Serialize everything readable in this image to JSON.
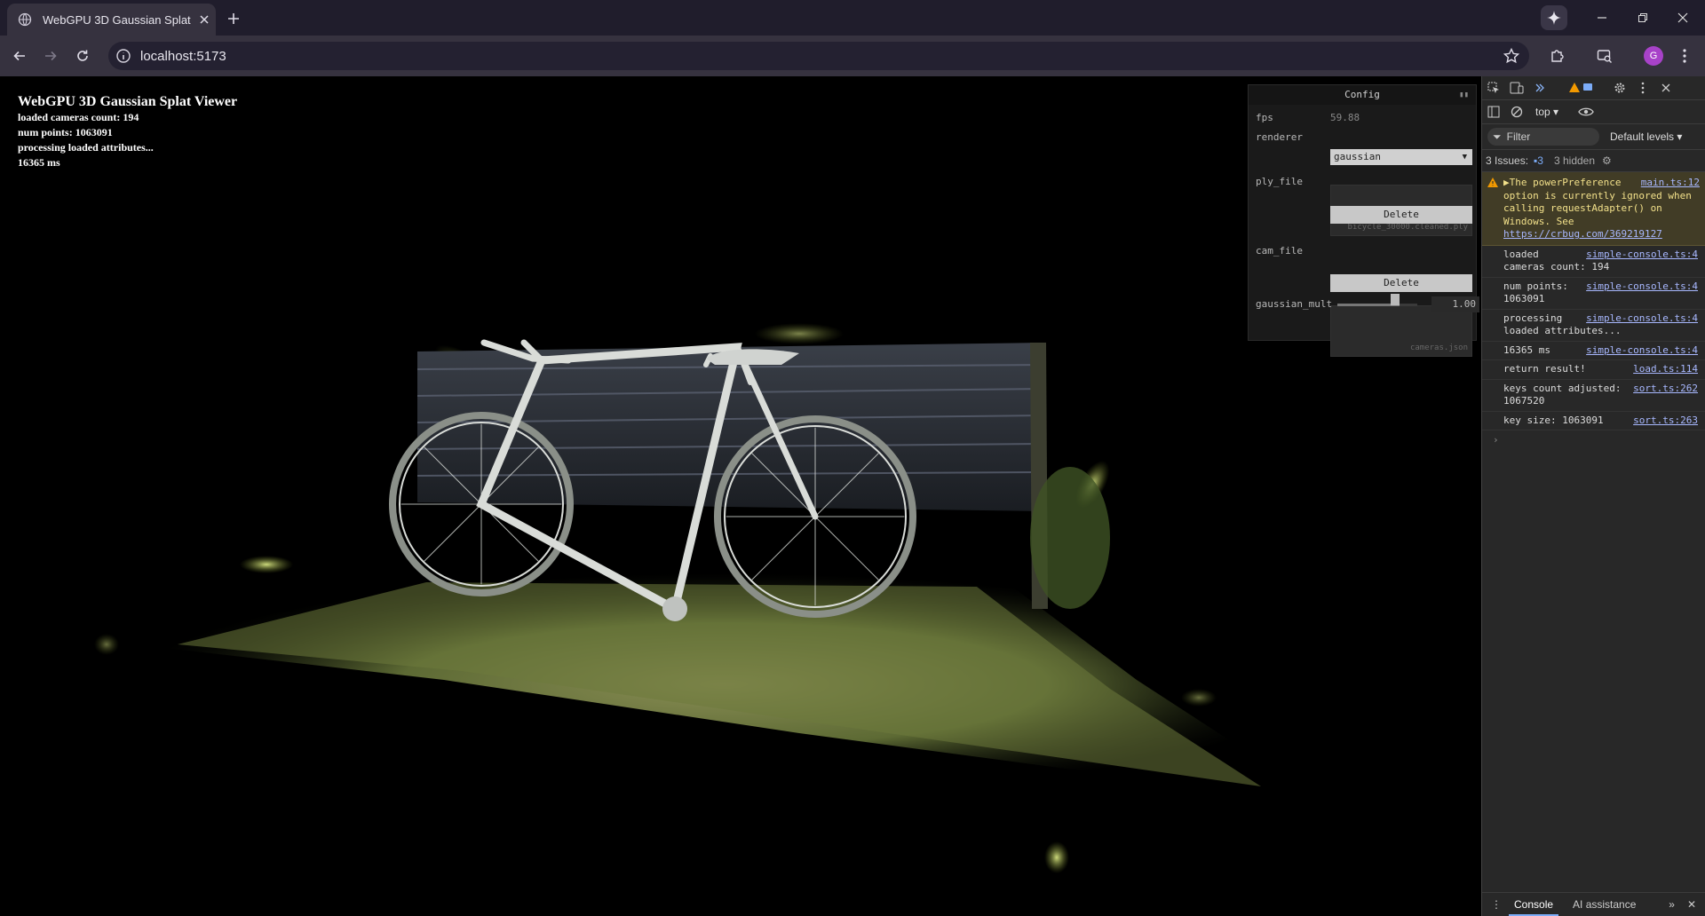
{
  "browser": {
    "tab_title": "WebGPU 3D Gaussian Splat Viewer",
    "url": "localhost:5173",
    "avatar_letter": "G"
  },
  "overlay": {
    "title": "WebGPU 3D Gaussian Splat Viewer",
    "lines": [
      "loaded cameras count: 194",
      "num points: 1063091",
      "processing loaded attributes...",
      "16365 ms"
    ]
  },
  "config": {
    "header": "Config",
    "fps_label": "fps",
    "fps_value": "59.88",
    "renderer_label": "renderer",
    "renderer_value": "gaussian",
    "ply_label": "ply_file",
    "ply_value": "bicycle_30000.cleaned.ply",
    "ply_delete": "Delete",
    "cam_label": "cam_file",
    "cam_value": "cameras.json",
    "cam_delete": "Delete",
    "mult_label": "gaussian_mult",
    "mult_value": "1.00",
    "mult_level": 1.0
  },
  "devtools": {
    "context": "top",
    "filter_placeholder": "Filter",
    "levels": "Default levels",
    "issues_label": "3 Issues:",
    "issues_count": "3",
    "hidden_label": "3 hidden",
    "warning": {
      "text": "The powerPreference option is currently ignored when calling requestAdapter() on Windows. See",
      "link": "https://crbug.com/369219127",
      "source": "main.ts:12"
    },
    "messages": [
      {
        "text": "loaded cameras count: 194",
        "source": "simple-console.ts:4"
      },
      {
        "text": "num points: 1063091",
        "source": "simple-console.ts:4"
      },
      {
        "text": "processing loaded attributes...",
        "source": "simple-console.ts:4"
      },
      {
        "text": "16365 ms",
        "source": "simple-console.ts:4"
      },
      {
        "text": "return result!",
        "source": "load.ts:114"
      },
      {
        "text": "keys count adjusted: 1067520",
        "source": "sort.ts:262"
      },
      {
        "text": "key size: 1063091",
        "source": "sort.ts:263"
      }
    ],
    "bottom_tabs": [
      "Console",
      "AI assistance"
    ]
  },
  "colors": {
    "chrome_dark": "#201d2c",
    "chrome_toolbar": "#36323f",
    "warning_bg": "#413c26",
    "link": "#a8b8ff"
  }
}
